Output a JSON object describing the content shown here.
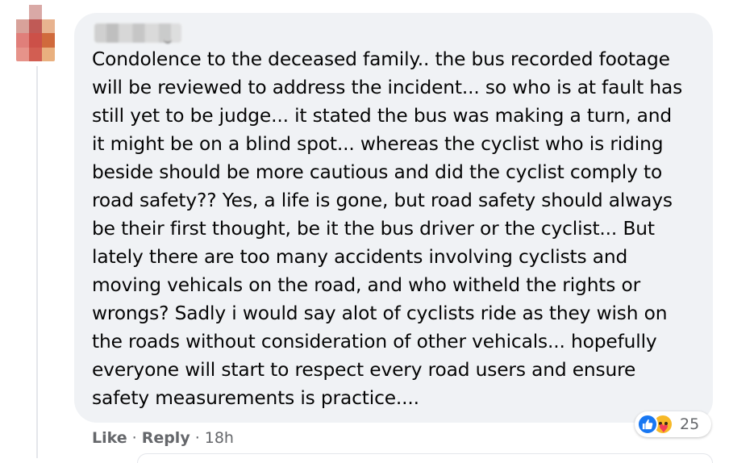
{
  "comment": {
    "lines": [
      "Condolence to the deceased family.. the bus recorded footage",
      "will be reviewed to address the incident... so who is at fault has",
      "still yet to be judge... it stated the bus was making a turn, and",
      "it might be on a blind spot... whereas the cyclist who is riding",
      "beside should be more cautious and did the cyclist comply to",
      "road safety?? Yes, a life is gone, but road safety should always",
      "be their first thought, be it the bus driver or the cyclist... But",
      "lately there are too many accidents involving cyclists and",
      "moving vehicals on the road, and who witheld the rights or",
      "wrongs? Sadly i would say alot of cyclists ride as they wish on",
      "the roads without consideration of other vehicals... hopefully",
      "everyone will start to respect every road users and ensure",
      "safety measurements is practice...."
    ],
    "reactions": {
      "icons": [
        "like-reaction-icon",
        "care-reaction-icon"
      ],
      "count": "25"
    },
    "actions": {
      "like_label": "Like",
      "separator": "·",
      "reply_label": "Reply",
      "timestamp": "18h"
    }
  },
  "colors": {
    "bubble_bg": "#f0f2f5",
    "text": "#050505",
    "meta": "#65676b",
    "like_blue": "#1877f2",
    "care_yellow": "#f7b928"
  }
}
